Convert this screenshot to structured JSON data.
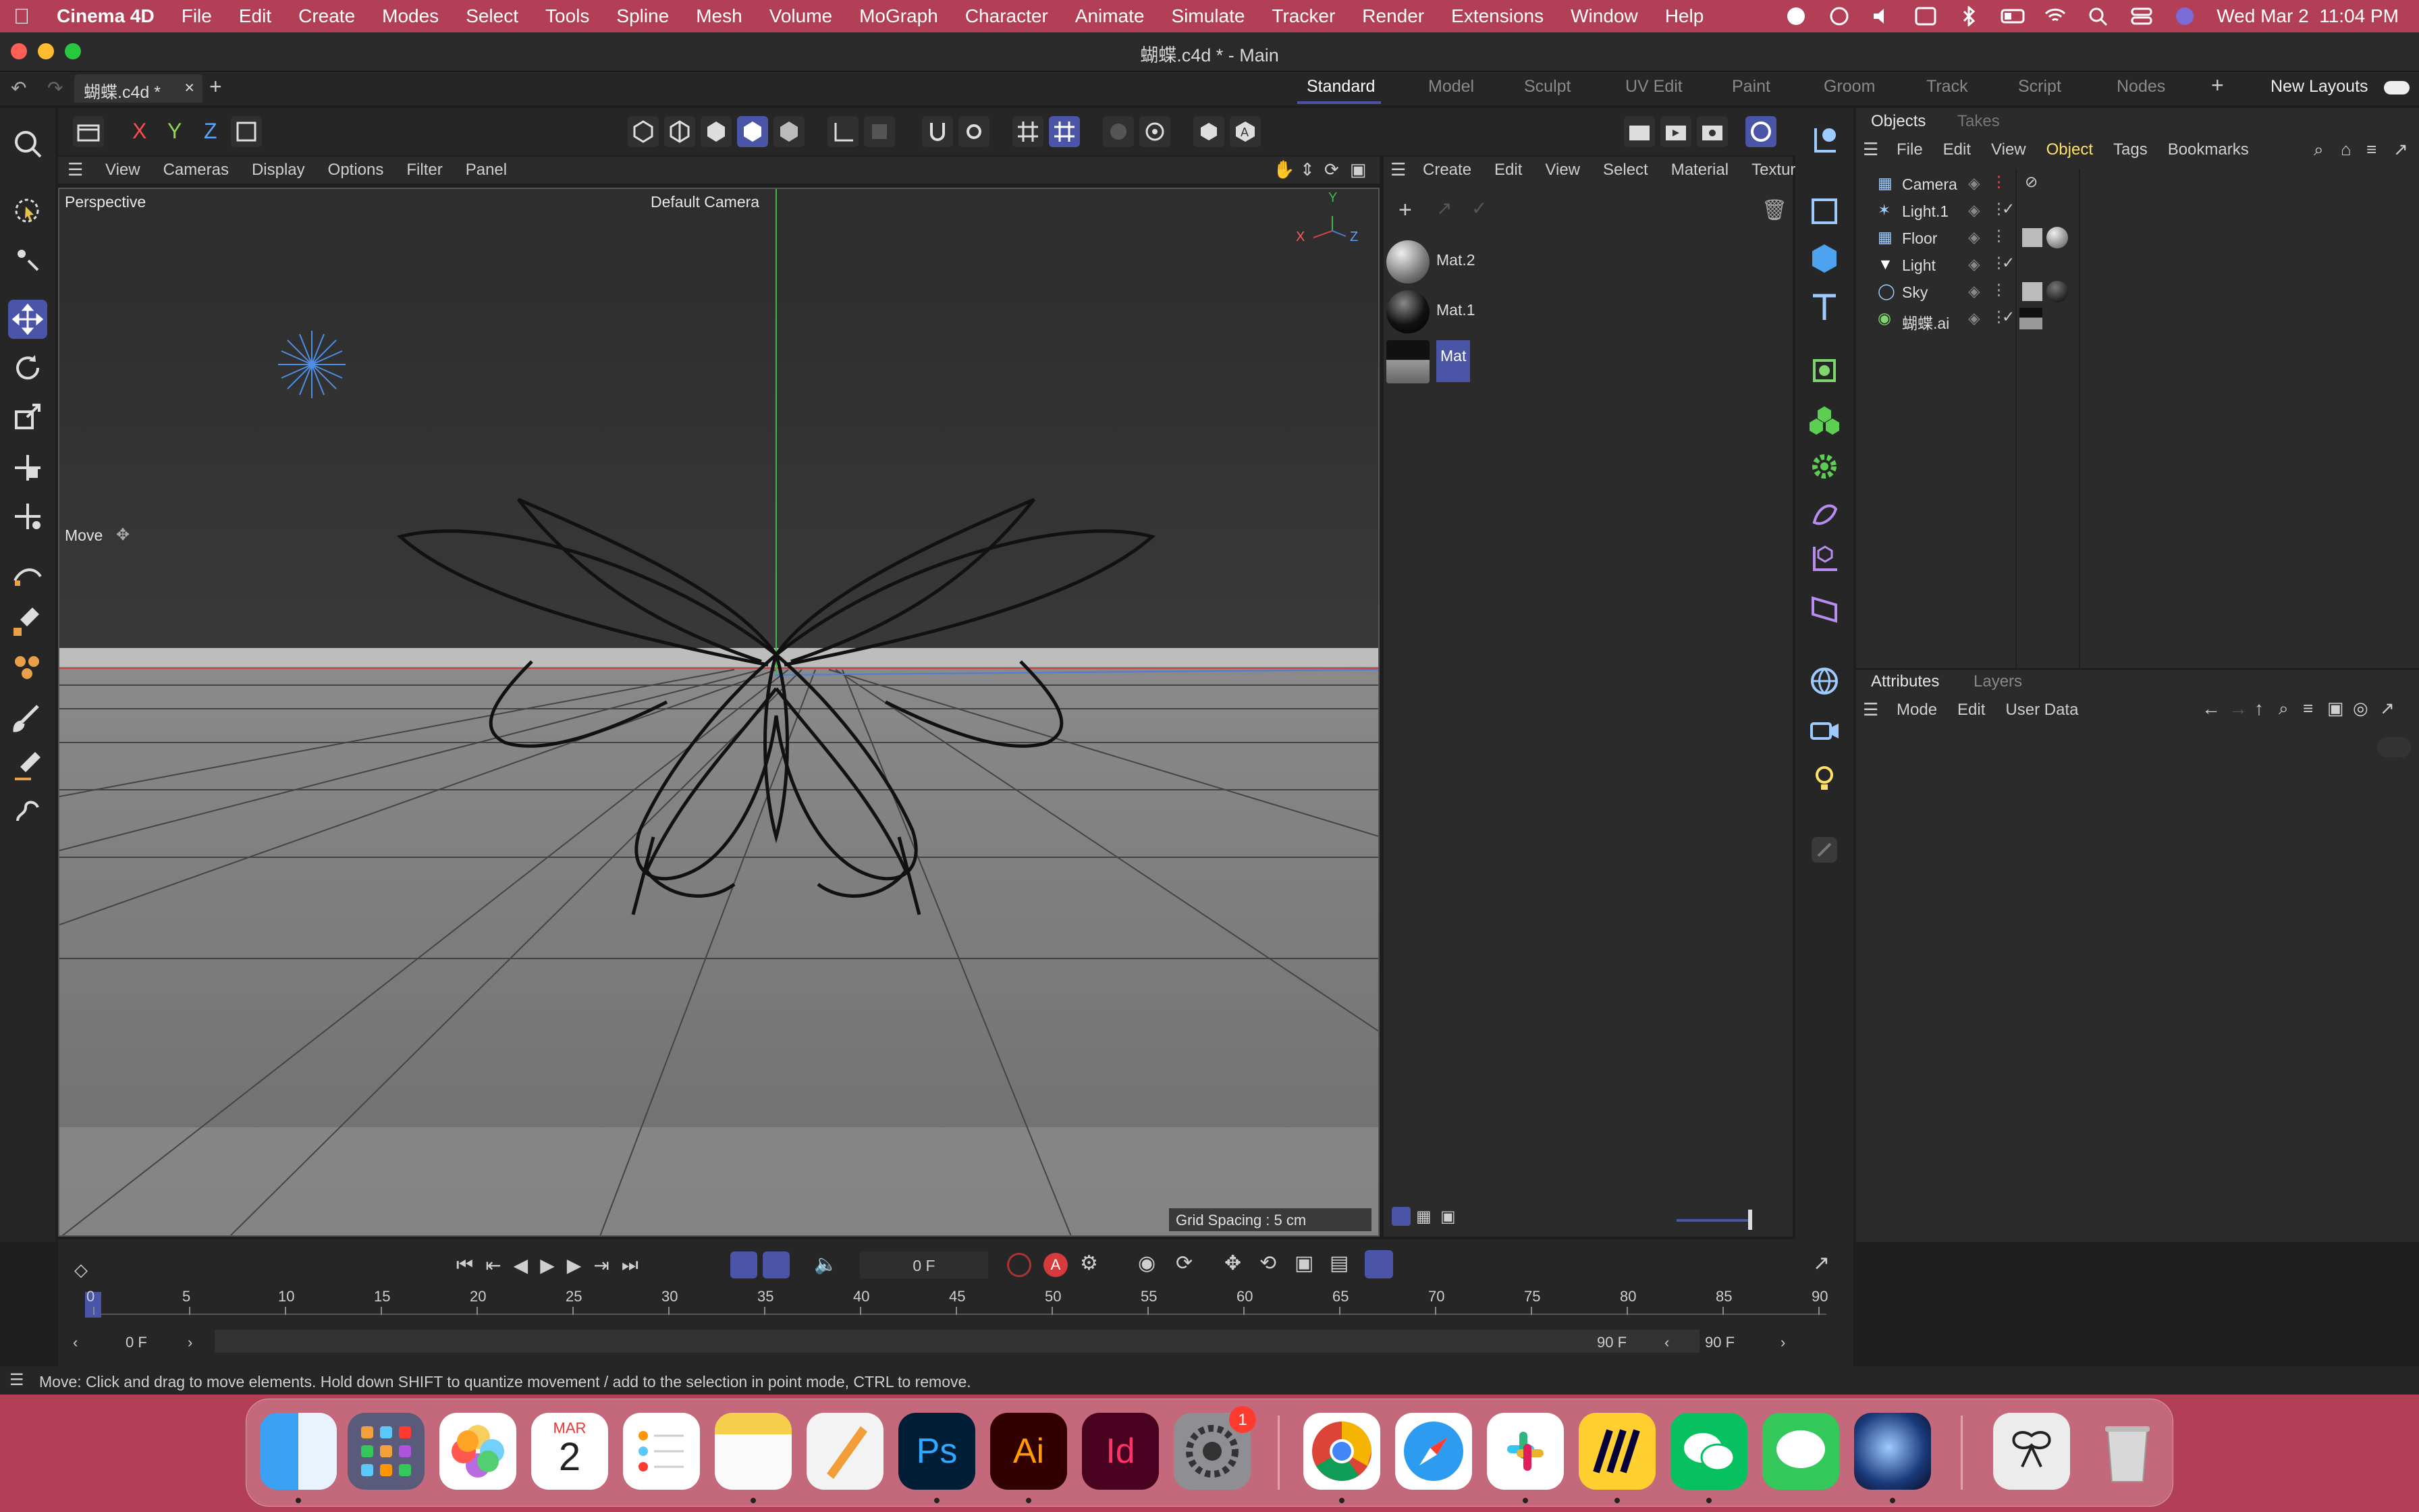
{
  "menubar": {
    "app_name": "Cinema 4D",
    "items": [
      "File",
      "Edit",
      "Create",
      "Modes",
      "Select",
      "Tools",
      "Spline",
      "Mesh",
      "Volume",
      "MoGraph",
      "Character",
      "Animate",
      "Simulate",
      "Tracker",
      "Render",
      "Extensions",
      "Window",
      "Help"
    ],
    "datetime": "Wed Mar 2  11:04 PM"
  },
  "window": {
    "title": "蝴蝶.c4d * - Main",
    "doc_tab": "蝴蝶.c4d *"
  },
  "layouts": {
    "tabs": [
      "Standard",
      "Model",
      "Sculpt",
      "UV Edit",
      "Paint",
      "Groom",
      "Track",
      "Script",
      "Nodes"
    ],
    "active": "Standard",
    "new_layouts": "New Layouts"
  },
  "toolbar": {
    "axis_x": "X",
    "axis_y": "Y",
    "axis_z": "Z"
  },
  "viewport": {
    "menu": [
      "View",
      "Cameras",
      "Display",
      "Options",
      "Filter",
      "Panel"
    ],
    "view_name": "Perspective",
    "camera": "Default Camera",
    "tool_label": "Move",
    "grid_spacing": "Grid Spacing : 5 cm",
    "gizmo_x": "X",
    "gizmo_y": "Y",
    "gizmo_z": "Z"
  },
  "materials": {
    "menu": [
      "Create",
      "Edit",
      "View",
      "Select",
      "Material",
      "Texture"
    ],
    "items": [
      "Mat.2",
      "Mat.1",
      "Mat"
    ],
    "selected": "Mat"
  },
  "objects": {
    "tabs": [
      "Objects",
      "Takes"
    ],
    "menu": [
      "File",
      "Edit",
      "View",
      "Object",
      "Tags",
      "Bookmarks"
    ],
    "active_menu": "Object",
    "rows": [
      "Camera",
      "Light.1",
      "Floor",
      "Light",
      "Sky",
      "蝴蝶.ai"
    ]
  },
  "attributes": {
    "tabs": [
      "Attributes",
      "Layers"
    ],
    "menu": [
      "Mode",
      "Edit",
      "User Data"
    ]
  },
  "timeline": {
    "current_frame": "0 F",
    "start_field": "0 F",
    "start_field2": "0 F",
    "end_field": "90 F",
    "end_field2": "90 F",
    "ticks": [
      "0",
      "5",
      "10",
      "15",
      "20",
      "25",
      "30",
      "35",
      "40",
      "45",
      "50",
      "55",
      "60",
      "65",
      "70",
      "75",
      "80",
      "85",
      "90"
    ]
  },
  "status": {
    "text": "Move: Click and drag to move elements. Hold down SHIFT to quantize movement / add to the selection in point mode, CTRL to remove."
  },
  "dock": {
    "calendar_month": "MAR",
    "calendar_day": "2",
    "settings_badge": "1",
    "ps_label": "Ps",
    "ai_label": "Ai",
    "id_label": "Id"
  },
  "colors": {
    "accent": "#4a55a8",
    "menubar_bg": "#b23f56"
  }
}
